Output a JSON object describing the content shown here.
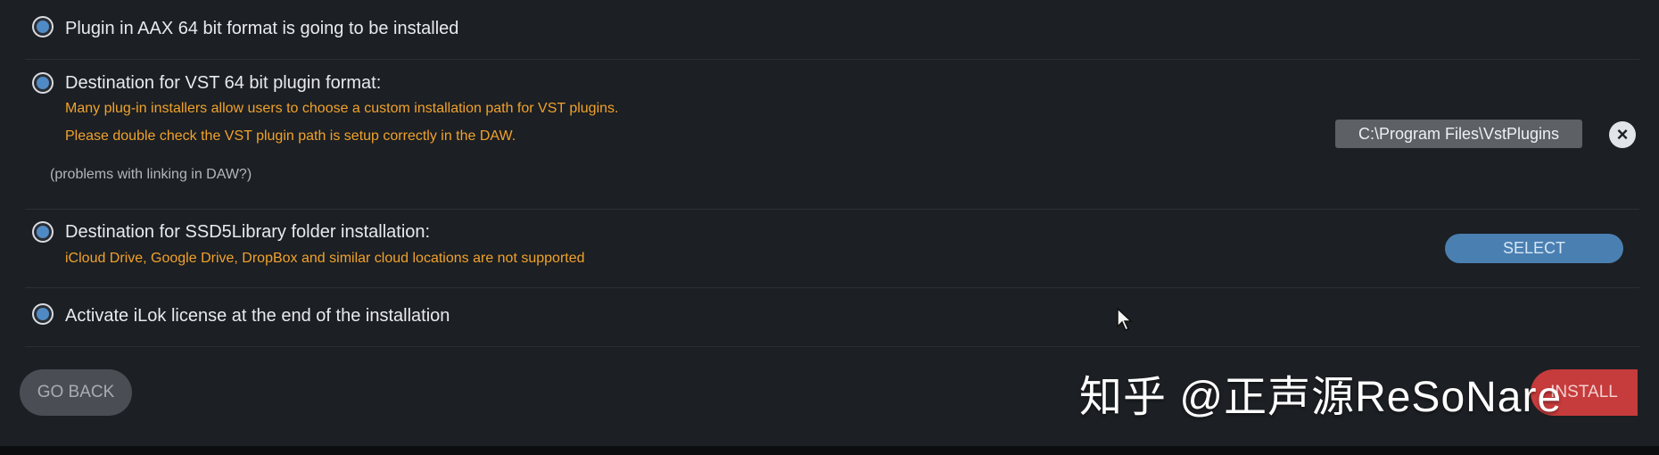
{
  "options": [
    {
      "title": "Plugin in AAX 64 bit format is going to be installed"
    },
    {
      "title": "Destination for VST 64 bit plugin format:",
      "notes": [
        "Many plug-in installers allow users to choose a custom installation path for VST plugins.",
        "Please double check the VST plugin path is setup correctly in the DAW."
      ],
      "help_text": "(problems with linking in DAW?)",
      "path_value": "C:\\Program Files\\VstPlugins",
      "clear_icon": "close-icon"
    },
    {
      "title": "Destination for SSD5Library folder installation:",
      "notes": [
        "iCloud Drive, Google Drive, DropBox and similar cloud locations are not supported"
      ],
      "select_label": "SELECT"
    },
    {
      "title": "Activate iLok license at the end of the installation"
    }
  ],
  "footer": {
    "back_label": "GO BACK",
    "install_label": "INSTALL",
    "watermark": "知乎 @正声源ReSoNare"
  },
  "colors": {
    "accent_blue": "#4a7fb1",
    "warning_orange": "#f0a22c",
    "danger_red": "#c63b3b",
    "background": "#1c1f23"
  }
}
